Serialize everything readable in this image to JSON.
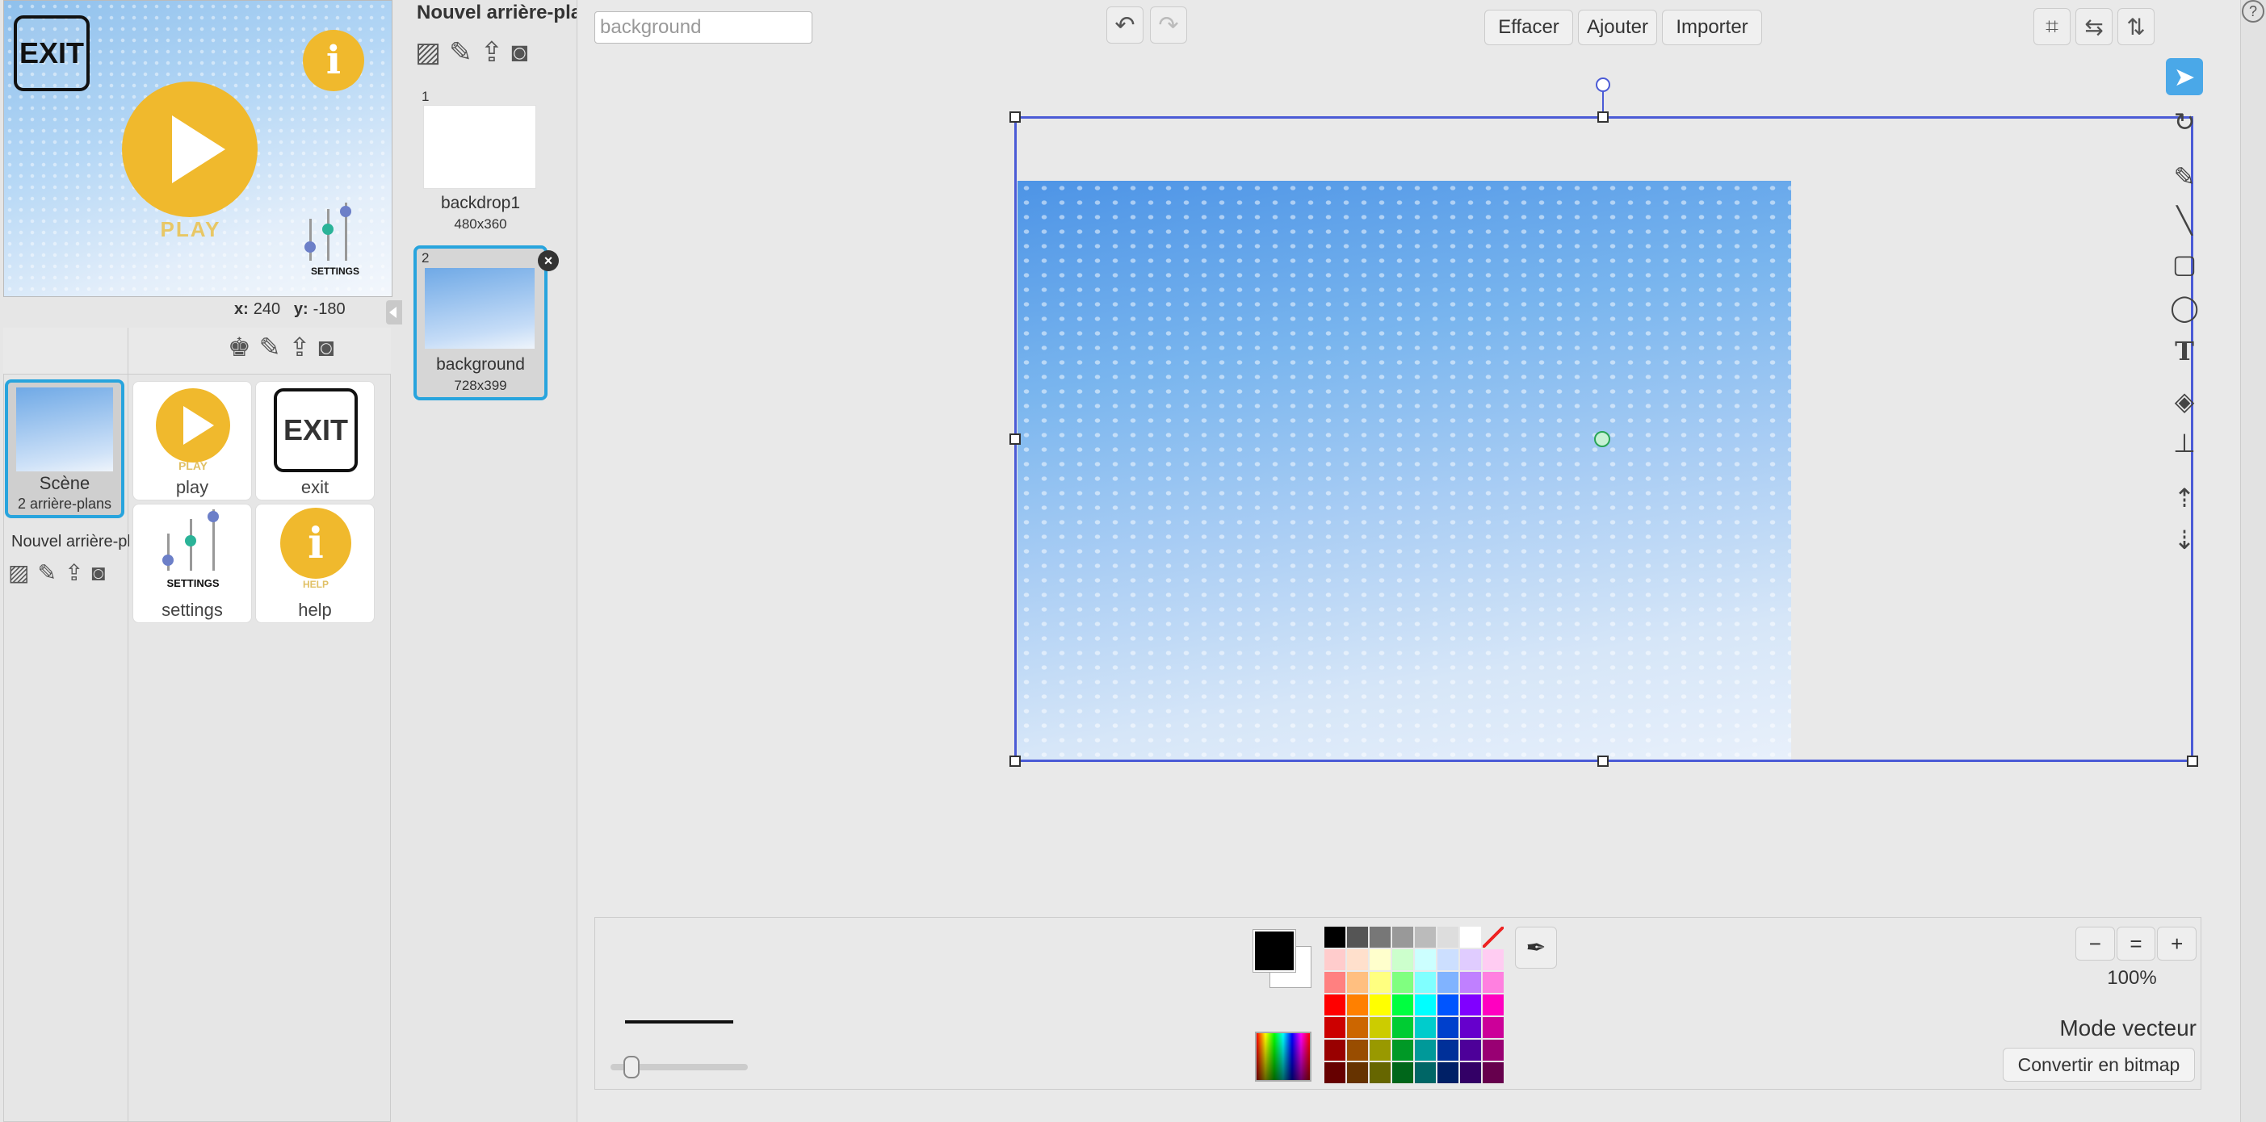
{
  "stage": {
    "exit_label": "EXIT",
    "info_label": "i",
    "play_label": "PLAY",
    "settings_label": "SETTINGS",
    "coords": {
      "x_label": "x:",
      "x_value": "240",
      "y_label": "y:",
      "y_value": "-180"
    }
  },
  "sprites": {
    "scene": {
      "name": "Scène",
      "count": "2 arrière-plans"
    },
    "new_backdrop_label": "Nouvel arrière-plan",
    "items": [
      {
        "name": "play",
        "label": "PLAY"
      },
      {
        "name": "exit",
        "label": "EXIT"
      },
      {
        "name": "settings",
        "label": "SETTINGS"
      },
      {
        "name": "help",
        "label": "HELP"
      }
    ]
  },
  "backdrops": {
    "title": "Nouvel arrière-plan",
    "items": [
      {
        "num": "1",
        "name": "backdrop1",
        "size": "480x360"
      },
      {
        "num": "2",
        "name": "background",
        "size": "728x399"
      }
    ],
    "delete_icon": "×"
  },
  "editor": {
    "name_value": "background",
    "buttons": {
      "clear": "Effacer",
      "add": "Ajouter",
      "import": "Importer"
    },
    "zoom_level": "100%",
    "mode": "Mode vecteur",
    "convert": "Convertir en bitmap",
    "help": "?"
  },
  "palette": [
    "#000000",
    "#555555",
    "#777777",
    "#999999",
    "#bbbbbb",
    "#dddddd",
    "#ffffff",
    "none",
    "#ffcccc",
    "#ffe0cc",
    "#ffffcc",
    "#ccffcc",
    "#ccffff",
    "#ccdfff",
    "#e0ccff",
    "#ffccf2",
    "#ff8080",
    "#ffbf80",
    "#ffff80",
    "#80ff80",
    "#80ffff",
    "#80b3ff",
    "#c080ff",
    "#ff80e0",
    "#ff0000",
    "#ff8000",
    "#ffff00",
    "#00ff40",
    "#00ffff",
    "#0055ff",
    "#8000ff",
    "#ff00c0",
    "#cc0000",
    "#cc6600",
    "#cccc00",
    "#00cc33",
    "#00cccc",
    "#0040cc",
    "#6600cc",
    "#cc0099",
    "#990000",
    "#994d00",
    "#999900",
    "#009926",
    "#009999",
    "#003099",
    "#4d0099",
    "#990073",
    "#660000",
    "#663300",
    "#666600",
    "#00661a",
    "#006666",
    "#002066",
    "#330066",
    "#66004d"
  ]
}
